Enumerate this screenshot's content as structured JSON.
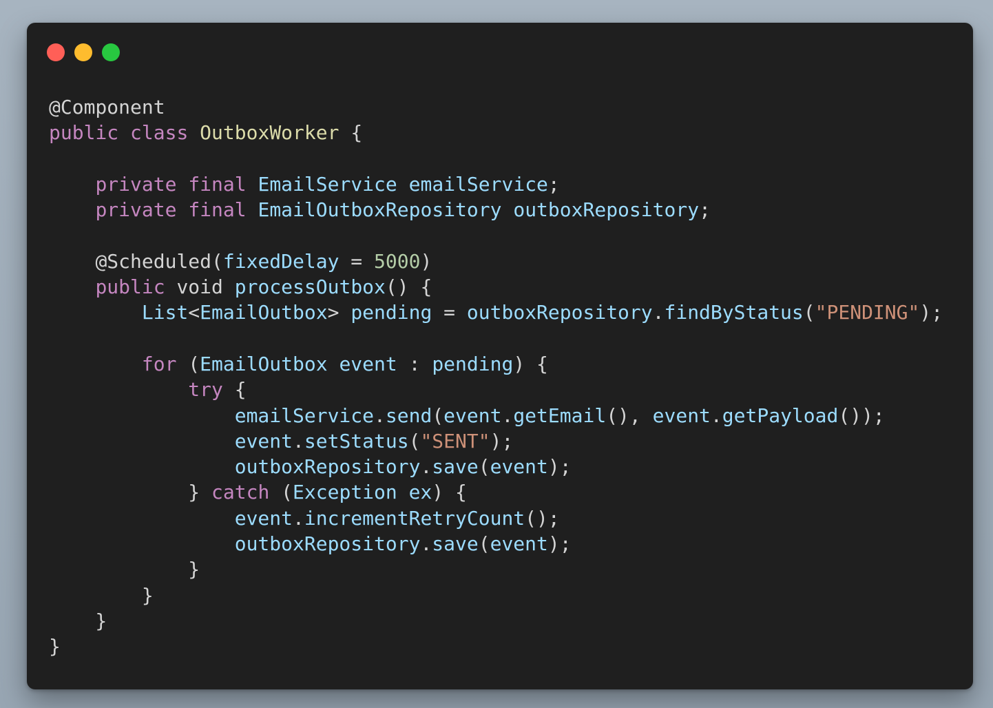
{
  "window": {
    "controls": {
      "close": {
        "icon": "close-dot-icon",
        "color": "#ff5f57"
      },
      "minimize": {
        "icon": "minimize-dot-icon",
        "color": "#febc2e"
      },
      "maximize": {
        "icon": "maximize-dot-icon",
        "color": "#28c840"
      }
    },
    "background": "#1f1f1f"
  },
  "colors": {
    "plain": "#d4d4d4",
    "keyword": "#c586c0",
    "class": "#dcdcaa",
    "identifier": "#9cdcfe",
    "string": "#ce9178",
    "number": "#b5cea8"
  },
  "code": {
    "language": "java",
    "lines": [
      [
        {
          "t": "@Component",
          "k": "annotation"
        }
      ],
      [
        {
          "t": "public",
          "k": "keyword"
        },
        {
          "t": " ",
          "k": "plain"
        },
        {
          "t": "class",
          "k": "keyword"
        },
        {
          "t": " ",
          "k": "plain"
        },
        {
          "t": "OutboxWorker",
          "k": "class"
        },
        {
          "t": " {",
          "k": "punct"
        }
      ],
      [],
      [
        {
          "t": "    ",
          "k": "plain"
        },
        {
          "t": "private",
          "k": "keyword"
        },
        {
          "t": " ",
          "k": "plain"
        },
        {
          "t": "final",
          "k": "keyword"
        },
        {
          "t": " ",
          "k": "plain"
        },
        {
          "t": "EmailService",
          "k": "type"
        },
        {
          "t": " ",
          "k": "plain"
        },
        {
          "t": "emailService",
          "k": "ident"
        },
        {
          "t": ";",
          "k": "punct"
        }
      ],
      [
        {
          "t": "    ",
          "k": "plain"
        },
        {
          "t": "private",
          "k": "keyword"
        },
        {
          "t": " ",
          "k": "plain"
        },
        {
          "t": "final",
          "k": "keyword"
        },
        {
          "t": " ",
          "k": "plain"
        },
        {
          "t": "EmailOutboxRepository",
          "k": "type"
        },
        {
          "t": " ",
          "k": "plain"
        },
        {
          "t": "outboxRepository",
          "k": "ident"
        },
        {
          "t": ";",
          "k": "punct"
        }
      ],
      [],
      [
        {
          "t": "    ",
          "k": "plain"
        },
        {
          "t": "@Scheduled",
          "k": "annotation"
        },
        {
          "t": "(",
          "k": "punct"
        },
        {
          "t": "fixedDelay",
          "k": "ident"
        },
        {
          "t": " = ",
          "k": "punct"
        },
        {
          "t": "5000",
          "k": "number"
        },
        {
          "t": ")",
          "k": "punct"
        }
      ],
      [
        {
          "t": "    ",
          "k": "plain"
        },
        {
          "t": "public",
          "k": "keyword"
        },
        {
          "t": " ",
          "k": "plain"
        },
        {
          "t": "void",
          "k": "plain"
        },
        {
          "t": " ",
          "k": "plain"
        },
        {
          "t": "processOutbox",
          "k": "method"
        },
        {
          "t": "() {",
          "k": "punct"
        }
      ],
      [
        {
          "t": "        ",
          "k": "plain"
        },
        {
          "t": "List",
          "k": "type"
        },
        {
          "t": "<",
          "k": "punct"
        },
        {
          "t": "EmailOutbox",
          "k": "type"
        },
        {
          "t": ">",
          "k": "punct"
        },
        {
          "t": " ",
          "k": "plain"
        },
        {
          "t": "pending",
          "k": "ident"
        },
        {
          "t": " = ",
          "k": "punct"
        },
        {
          "t": "outboxRepository",
          "k": "ident"
        },
        {
          "t": ".",
          "k": "punct"
        },
        {
          "t": "findByStatus",
          "k": "method"
        },
        {
          "t": "(",
          "k": "punct"
        },
        {
          "t": "\"PENDING\"",
          "k": "string"
        },
        {
          "t": ");",
          "k": "punct"
        }
      ],
      [],
      [
        {
          "t": "        ",
          "k": "plain"
        },
        {
          "t": "for",
          "k": "keyword"
        },
        {
          "t": " (",
          "k": "punct"
        },
        {
          "t": "EmailOutbox",
          "k": "type"
        },
        {
          "t": " ",
          "k": "plain"
        },
        {
          "t": "event",
          "k": "ident"
        },
        {
          "t": " : ",
          "k": "punct"
        },
        {
          "t": "pending",
          "k": "ident"
        },
        {
          "t": ") {",
          "k": "punct"
        }
      ],
      [
        {
          "t": "            ",
          "k": "plain"
        },
        {
          "t": "try",
          "k": "keyword"
        },
        {
          "t": " {",
          "k": "punct"
        }
      ],
      [
        {
          "t": "                ",
          "k": "plain"
        },
        {
          "t": "emailService",
          "k": "ident"
        },
        {
          "t": ".",
          "k": "punct"
        },
        {
          "t": "send",
          "k": "method"
        },
        {
          "t": "(",
          "k": "punct"
        },
        {
          "t": "event",
          "k": "ident"
        },
        {
          "t": ".",
          "k": "punct"
        },
        {
          "t": "getEmail",
          "k": "method"
        },
        {
          "t": "(), ",
          "k": "punct"
        },
        {
          "t": "event",
          "k": "ident"
        },
        {
          "t": ".",
          "k": "punct"
        },
        {
          "t": "getPayload",
          "k": "method"
        },
        {
          "t": "());",
          "k": "punct"
        }
      ],
      [
        {
          "t": "                ",
          "k": "plain"
        },
        {
          "t": "event",
          "k": "ident"
        },
        {
          "t": ".",
          "k": "punct"
        },
        {
          "t": "setStatus",
          "k": "method"
        },
        {
          "t": "(",
          "k": "punct"
        },
        {
          "t": "\"SENT\"",
          "k": "string"
        },
        {
          "t": ");",
          "k": "punct"
        }
      ],
      [
        {
          "t": "                ",
          "k": "plain"
        },
        {
          "t": "outboxRepository",
          "k": "ident"
        },
        {
          "t": ".",
          "k": "punct"
        },
        {
          "t": "save",
          "k": "method"
        },
        {
          "t": "(",
          "k": "punct"
        },
        {
          "t": "event",
          "k": "ident"
        },
        {
          "t": ");",
          "k": "punct"
        }
      ],
      [
        {
          "t": "            } ",
          "k": "punct"
        },
        {
          "t": "catch",
          "k": "keyword"
        },
        {
          "t": " (",
          "k": "punct"
        },
        {
          "t": "Exception",
          "k": "type"
        },
        {
          "t": " ",
          "k": "plain"
        },
        {
          "t": "ex",
          "k": "ident"
        },
        {
          "t": ") {",
          "k": "punct"
        }
      ],
      [
        {
          "t": "                ",
          "k": "plain"
        },
        {
          "t": "event",
          "k": "ident"
        },
        {
          "t": ".",
          "k": "punct"
        },
        {
          "t": "incrementRetryCount",
          "k": "method"
        },
        {
          "t": "();",
          "k": "punct"
        }
      ],
      [
        {
          "t": "                ",
          "k": "plain"
        },
        {
          "t": "outboxRepository",
          "k": "ident"
        },
        {
          "t": ".",
          "k": "punct"
        },
        {
          "t": "save",
          "k": "method"
        },
        {
          "t": "(",
          "k": "punct"
        },
        {
          "t": "event",
          "k": "ident"
        },
        {
          "t": ");",
          "k": "punct"
        }
      ],
      [
        {
          "t": "            }",
          "k": "punct"
        }
      ],
      [
        {
          "t": "        }",
          "k": "punct"
        }
      ],
      [
        {
          "t": "    }",
          "k": "punct"
        }
      ],
      [
        {
          "t": "}",
          "k": "punct"
        }
      ]
    ]
  }
}
